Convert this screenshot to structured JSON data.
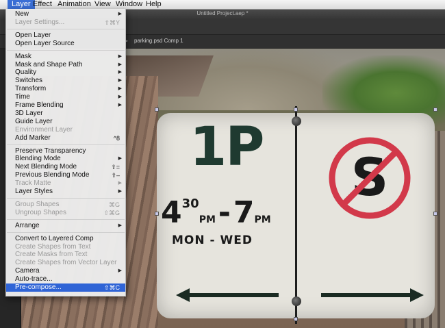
{
  "menubar": {
    "items": [
      "Layer",
      "Effect",
      "Animation",
      "View",
      "Window",
      "Help"
    ],
    "active": "Layer"
  },
  "window": {
    "title": "Untitled Project.aep *"
  },
  "panel": {
    "tab": "parking.psd Comp 1"
  },
  "sign": {
    "big": "1P",
    "time_hour1": "4",
    "time_min1": "30",
    "time_pm1": "PM",
    "time_dash": "-",
    "time_hour2": "7",
    "time_pm2": "PM",
    "days": "MON - WED",
    "no_stopping_letter": "S"
  },
  "menu": {
    "items": [
      {
        "label": "New",
        "shortcut": "",
        "submenu": true,
        "disabled": false
      },
      {
        "label": "Layer Settings...",
        "shortcut": "⇧⌘Y",
        "submenu": false,
        "disabled": true
      },
      {
        "sep": true
      },
      {
        "label": "Open Layer",
        "shortcut": "",
        "submenu": false,
        "disabled": false
      },
      {
        "label": "Open Layer Source",
        "shortcut": "",
        "submenu": false,
        "disabled": false
      },
      {
        "sep": true
      },
      {
        "label": "Mask",
        "shortcut": "",
        "submenu": true,
        "disabled": false
      },
      {
        "label": "Mask and Shape Path",
        "shortcut": "",
        "submenu": true,
        "disabled": false
      },
      {
        "label": "Quality",
        "shortcut": "",
        "submenu": true,
        "disabled": false
      },
      {
        "label": "Switches",
        "shortcut": "",
        "submenu": true,
        "disabled": false
      },
      {
        "label": "Transform",
        "shortcut": "",
        "submenu": true,
        "disabled": false
      },
      {
        "label": "Time",
        "shortcut": "",
        "submenu": true,
        "disabled": false
      },
      {
        "label": "Frame Blending",
        "shortcut": "",
        "submenu": true,
        "disabled": false
      },
      {
        "label": "3D Layer",
        "shortcut": "",
        "submenu": false,
        "disabled": false
      },
      {
        "label": "Guide Layer",
        "shortcut": "",
        "submenu": false,
        "disabled": false
      },
      {
        "label": "Environment Layer",
        "shortcut": "",
        "submenu": false,
        "disabled": true
      },
      {
        "label": "Add Marker",
        "shortcut": "^8",
        "submenu": false,
        "disabled": false
      },
      {
        "sep": true
      },
      {
        "label": "Preserve Transparency",
        "shortcut": "",
        "submenu": false,
        "disabled": false
      },
      {
        "label": "Blending Mode",
        "shortcut": "",
        "submenu": true,
        "disabled": false
      },
      {
        "label": "Next Blending Mode",
        "shortcut": "⇧=",
        "submenu": false,
        "disabled": false
      },
      {
        "label": "Previous Blending Mode",
        "shortcut": "⇧–",
        "submenu": false,
        "disabled": false
      },
      {
        "label": "Track Matte",
        "shortcut": "",
        "submenu": true,
        "disabled": true
      },
      {
        "label": "Layer Styles",
        "shortcut": "",
        "submenu": true,
        "disabled": false
      },
      {
        "sep": true
      },
      {
        "label": "Group Shapes",
        "shortcut": "⌘G",
        "submenu": false,
        "disabled": true
      },
      {
        "label": "Ungroup Shapes",
        "shortcut": "⇧⌘G",
        "submenu": false,
        "disabled": true
      },
      {
        "sep": true
      },
      {
        "label": "Arrange",
        "shortcut": "",
        "submenu": true,
        "disabled": false
      },
      {
        "sep": true
      },
      {
        "label": "Convert to Layered Comp",
        "shortcut": "",
        "submenu": false,
        "disabled": false
      },
      {
        "label": "Create Shapes from Text",
        "shortcut": "",
        "submenu": false,
        "disabled": true
      },
      {
        "label": "Create Masks from Text",
        "shortcut": "",
        "submenu": false,
        "disabled": true
      },
      {
        "label": "Create Shapes from Vector Layer",
        "shortcut": "",
        "submenu": false,
        "disabled": true
      },
      {
        "label": "Camera",
        "shortcut": "",
        "submenu": true,
        "disabled": false
      },
      {
        "label": "Auto-trace...",
        "shortcut": "",
        "submenu": false,
        "disabled": false
      },
      {
        "label": "Pre-compose...",
        "shortcut": "⇧⌘C",
        "submenu": false,
        "disabled": false,
        "highlighted": true
      }
    ]
  },
  "colors": {
    "menu_highlight": "#2f64d6",
    "menubar_active": "#3b6fd6"
  }
}
